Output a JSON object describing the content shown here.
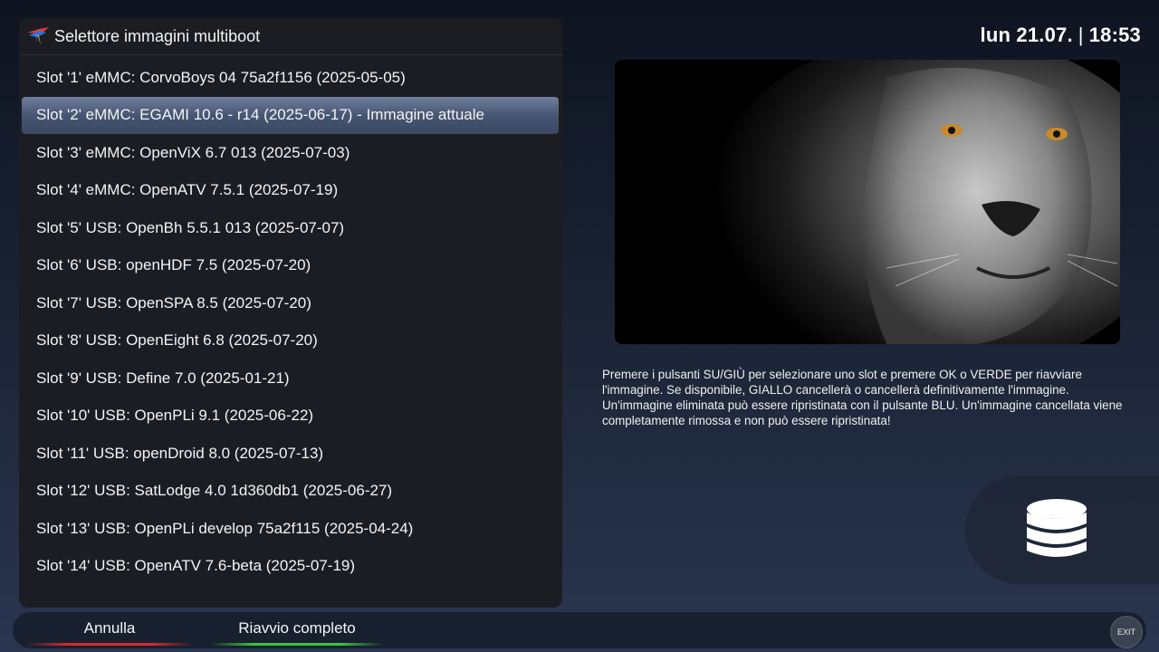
{
  "header": {
    "title": "Selettore immagini multiboot"
  },
  "clock": {
    "date": "lun 21.07.",
    "separator": "|",
    "time": "18:53"
  },
  "slots": [
    {
      "label": "Slot '1' eMMC: CorvoBoys 04 75a2f1156 (2025-05-05)"
    },
    {
      "label": "Slot '2' eMMC: EGAMI 10.6 - r14 (2025-06-17)  -  Immagine attuale"
    },
    {
      "label": "Slot '3' eMMC: OpenViX 6.7 013 (2025-07-03)"
    },
    {
      "label": "Slot '4' eMMC: OpenATV 7.5.1 (2025-07-19)"
    },
    {
      "label": "Slot '5' USB: OpenBh 5.5.1 013 (2025-07-07)"
    },
    {
      "label": "Slot '6' USB: openHDF 7.5 (2025-07-20)"
    },
    {
      "label": "Slot '7' USB: OpenSPA 8.5 (2025-07-20)"
    },
    {
      "label": "Slot '8' USB: OpenEight 6.8 (2025-07-20)"
    },
    {
      "label": "Slot '9' USB: Define 7.0 (2025-01-21)"
    },
    {
      "label": "Slot '10' USB: OpenPLi 9.1  (2025-06-22)"
    },
    {
      "label": "Slot '11' USB: openDroid 8.0 (2025-07-13)"
    },
    {
      "label": "Slot '12' USB: SatLodge 4.0 1d360db1 (2025-06-27)"
    },
    {
      "label": "Slot '13' USB: OpenPLi develop 75a2f115 (2025-04-24)"
    },
    {
      "label": "Slot '14' USB: OpenATV 7.6-beta (2025-07-19)"
    }
  ],
  "selected_index": 1,
  "description": "Premere i pulsanti SU/GIÙ per selezionare uno slot e premere OK o VERDE per riavviare l'immagine. Se disponibile, GIALLO cancellerà o cancellerà definitivamente l'immagine. Un'immagine eliminata può essere ripristinata con il pulsante BLU. Un'immagine cancellata viene completamente rimossa e non può essere ripristinata!",
  "buttons": {
    "red": {
      "label": "Annulla",
      "color": "#d62b2b"
    },
    "green": {
      "label": "Riavvio completo",
      "color": "#3fc23f"
    }
  },
  "exit": {
    "label": "EXIT"
  },
  "icons": {
    "logo": "bird-logo-icon",
    "storage": "database-icon"
  },
  "colors": {
    "selected_row": "#465672",
    "panel": "#1b1d22"
  }
}
